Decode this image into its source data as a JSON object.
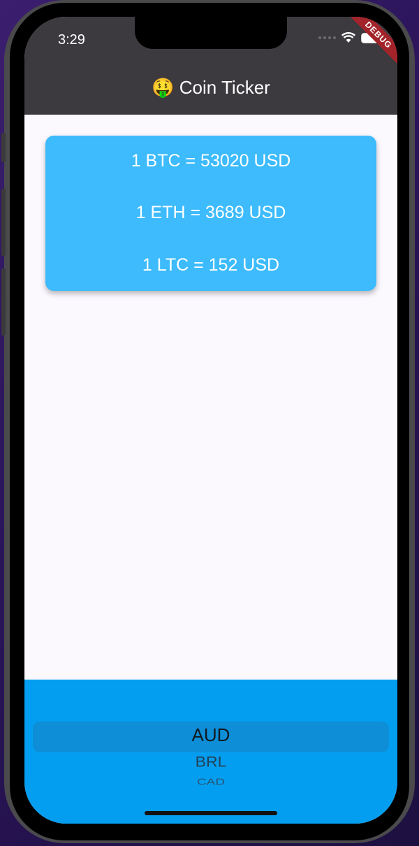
{
  "status_bar": {
    "time": "3:29",
    "debug_label": "DEBUG"
  },
  "app_bar": {
    "emoji": "🤑",
    "title": "Coin Ticker"
  },
  "rates": [
    {
      "text": "1 BTC = 53020 USD"
    },
    {
      "text": "1 ETH = 3689 USD"
    },
    {
      "text": "1 LTC = 152 USD"
    }
  ],
  "currency_picker": {
    "selected": "AUD",
    "items": [
      "AUD",
      "BRL",
      "CAD"
    ]
  },
  "colors": {
    "app_bar": "#3c3a3e",
    "card": "#3dbbfc",
    "picker_background": "#049ef0",
    "debug_banner": "#a2232a"
  }
}
